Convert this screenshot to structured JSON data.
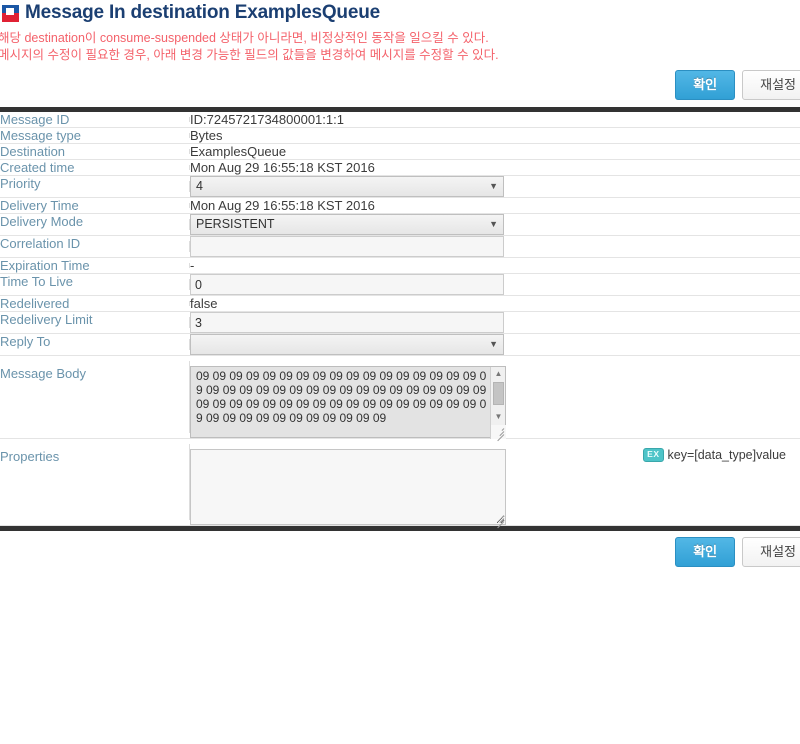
{
  "header": {
    "icon": "app-logo-icon",
    "title": "Message In destination ExamplesQueue",
    "title_color": "#1b3f72",
    "warnings": [
      "해당 destination이 consume-suspended 상태가 아니라면, 비정상적인 동작을 일으킬 수 있다.",
      "메시지의 수정이 필요한 경우, 아래 변경 가능한 필드의 값들을 변경하여 메시지를 수정할 수 있다."
    ],
    "warning_color": "#f4626b"
  },
  "actions": {
    "confirm_label": "확인",
    "reset_label": "재설정",
    "confirm_color": "#3fa9dc"
  },
  "fields": [
    {
      "label": "Message ID",
      "type": "text",
      "value": "ID:7245721734800001:1:1"
    },
    {
      "label": "Message type",
      "type": "text",
      "value": "Bytes"
    },
    {
      "label": "Destination",
      "type": "text",
      "value": "ExamplesQueue"
    },
    {
      "label": "Created time",
      "type": "text",
      "value": "Mon Aug 29 16:55:18 KST 2016"
    },
    {
      "label": "Priority",
      "type": "select",
      "value": "4"
    },
    {
      "label": "Delivery Time",
      "type": "text",
      "value": "Mon Aug 29 16:55:18 KST 2016"
    },
    {
      "label": "Delivery Mode",
      "type": "select",
      "value": "PERSISTENT"
    },
    {
      "label": "Correlation ID",
      "type": "input",
      "value": "",
      "placeholder": ""
    },
    {
      "label": "Expiration Time",
      "type": "text",
      "value": "-"
    },
    {
      "label": "Time To Live",
      "type": "input",
      "value": "0",
      "placeholder": ""
    },
    {
      "label": "Redelivered",
      "type": "text",
      "value": "false"
    },
    {
      "label": "Redelivery Limit",
      "type": "input",
      "value": "3",
      "placeholder": ""
    },
    {
      "label": "Reply To",
      "type": "select",
      "value": ""
    }
  ],
  "message_body": {
    "label": "Message Body",
    "value": "09 09 09 09 09 09 09 09 09 09 09 09 09 09 09 09 09 09 09 09 09 09 09 09 09 09 09 09 09 09 09 09 09 09 09 09 09 09 09 09 09 09 09 09 09 09 09 09 09 09 09 09 09 09 09 09 09 09 09 09 09 09 09 09",
    "scrollbar": {
      "up": "▲",
      "down": "▼"
    }
  },
  "properties": {
    "label": "Properties",
    "value": "",
    "placeholder": "",
    "hint_badge": "EX",
    "hint_text": "key=[data_type]value",
    "hint_badge_color": "#4dc4c8"
  },
  "select_caret": "▼"
}
